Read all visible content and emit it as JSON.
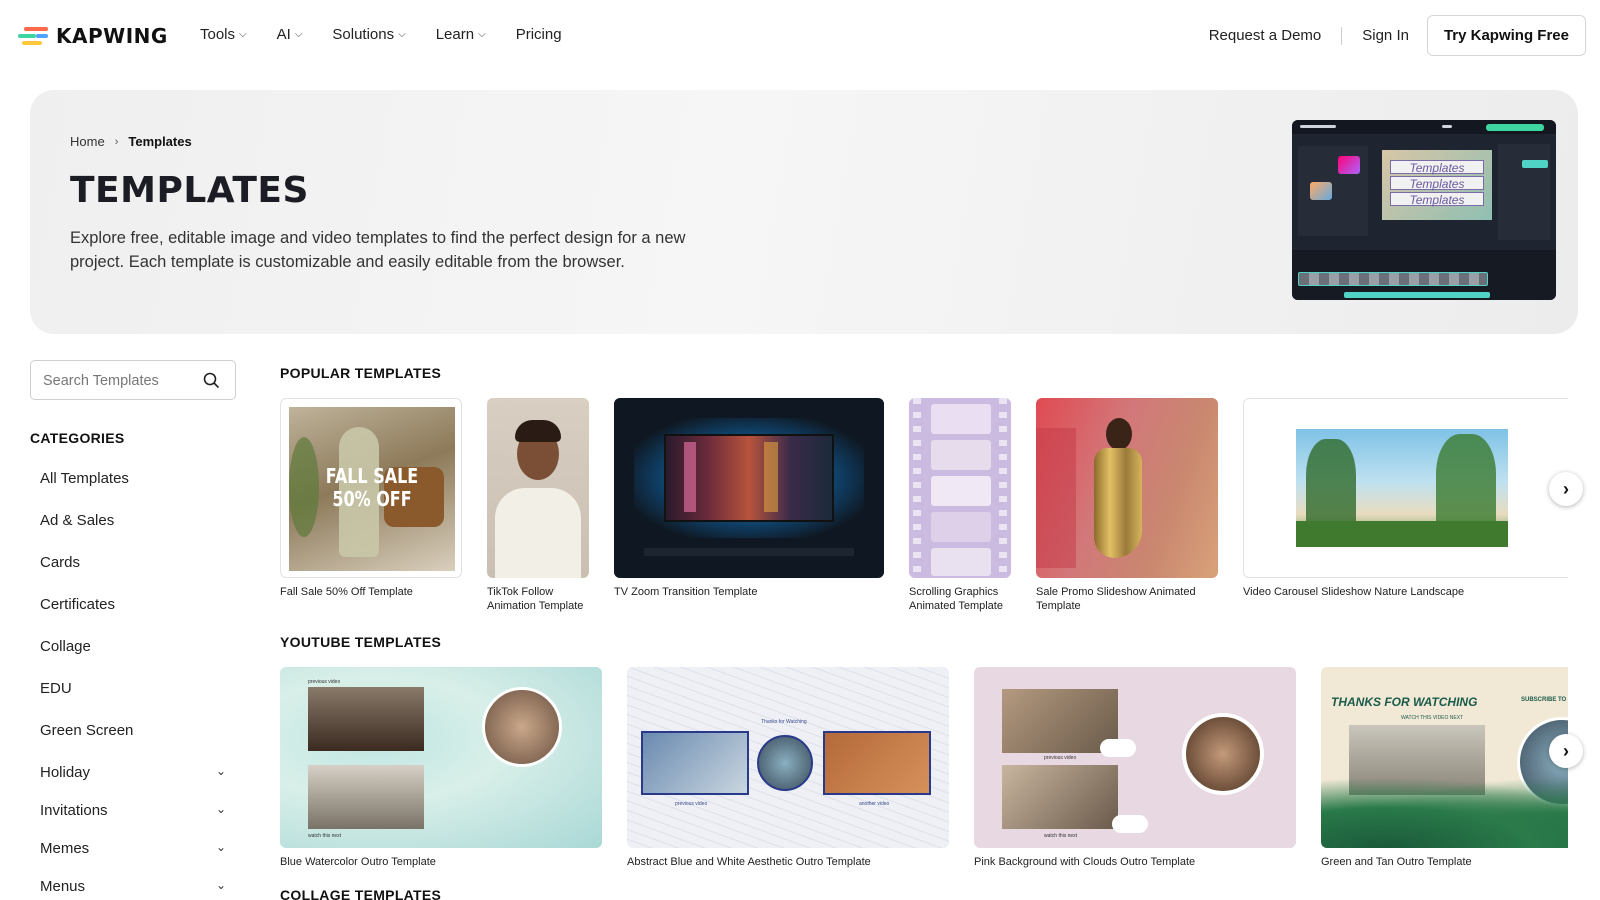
{
  "nav": {
    "brand": "KAPWING",
    "menu": [
      {
        "label": "Tools",
        "has_dropdown": true
      },
      {
        "label": "AI",
        "has_dropdown": true
      },
      {
        "label": "Solutions",
        "has_dropdown": true
      },
      {
        "label": "Learn",
        "has_dropdown": true
      },
      {
        "label": "Pricing",
        "has_dropdown": false
      }
    ],
    "dropdown_glyph": "⌵",
    "request_demo": "Request a Demo",
    "sign_in": "Sign In",
    "cta": "Try Kapwing Free"
  },
  "hero": {
    "breadcrumb": {
      "home": "Home",
      "separator": "›",
      "current": "Templates"
    },
    "title": "TEMPLATES",
    "description": "Explore free, editable image and video templates to find the perfect design for a new project. Each template is customizable and easily editable from the browser.",
    "preview_text": [
      "Templates",
      "Templates",
      "Templates"
    ]
  },
  "sidebar": {
    "search_placeholder": "Search Templates",
    "categories_heading": "CATEGORIES",
    "categories": [
      {
        "label": "All Templates",
        "expandable": false
      },
      {
        "label": "Ad & Sales",
        "expandable": false
      },
      {
        "label": "Cards",
        "expandable": false
      },
      {
        "label": "Certificates",
        "expandable": false
      },
      {
        "label": "Collage",
        "expandable": false
      },
      {
        "label": "EDU",
        "expandable": false
      },
      {
        "label": "Green Screen",
        "expandable": false
      },
      {
        "label": "Holiday",
        "expandable": true
      },
      {
        "label": "Invitations",
        "expandable": true
      },
      {
        "label": "Memes",
        "expandable": true
      },
      {
        "label": "Menus",
        "expandable": true
      }
    ],
    "expand_glyph": "⌄"
  },
  "sections": {
    "popular": {
      "title": "POPULAR TEMPLATES",
      "items": [
        {
          "caption": "Fall Sale 50% Off Template",
          "overlay": "FALL SALE\n50% OFF"
        },
        {
          "caption": "TikTok Follow Animation Template"
        },
        {
          "caption": "TV Zoom Transition Template"
        },
        {
          "caption": "Scrolling Graphics Animated Template"
        },
        {
          "caption": "Sale Promo Slideshow Animated Template"
        },
        {
          "caption": "Video Carousel Slideshow Nature Landscape"
        }
      ]
    },
    "youtube": {
      "title": "YOUTUBE TEMPLATES",
      "items": [
        {
          "caption": "Blue Watercolor Outro Template",
          "labels": [
            "previous video",
            "watch this next"
          ]
        },
        {
          "caption": "Abstract Blue and White Aesthetic Outro Template",
          "labels": [
            "Thanks for Watching",
            "previous video",
            "another video"
          ]
        },
        {
          "caption": "Pink Background with Clouds Outro Template",
          "labels": [
            "previous video",
            "watch this next"
          ]
        },
        {
          "caption": "Green and Tan Outro Template",
          "labels": [
            "THANKS FOR WATCHING",
            "WATCH THIS VIDEO NEXT",
            "SUBSCRIBE TO"
          ]
        }
      ]
    },
    "collage": {
      "title": "COLLAGE TEMPLATES"
    }
  },
  "next_arrow": "›",
  "colors": {
    "accent_green": "#3dd6a0",
    "accent_teal": "#4fd3c4",
    "title_dark": "#1c1c24"
  }
}
